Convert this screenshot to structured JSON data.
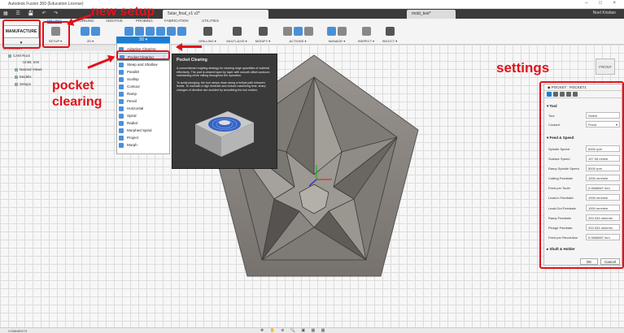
{
  "titlebar": {
    "app_title": "Autodesk Fusion 360 (Education License)"
  },
  "tabs": {
    "doc_tab_1": "5star_final_v1 v2*",
    "doc_tab_2": "mold_test*",
    "user": "Noel Kristian"
  },
  "ribbon": {
    "workspace": "MANUFACTURE",
    "tabs": [
      "MILLING",
      "TURNING",
      "ADDITIVE",
      "PROBING",
      "FABRICATION",
      "UTILITIES"
    ],
    "groups": {
      "setup": "SETUP",
      "twod": "2D",
      "threed": "3D",
      "drilling": "DRILLING",
      "multiaxis": "MULTI-AXIS",
      "modify": "MODIFY",
      "actions": "ACTIONS",
      "manage": "MANAGE",
      "inspect": "INSPECT",
      "select": "SELECT"
    }
  },
  "browser": {
    "header": "BROWSER",
    "items": [
      "CAM Root",
      "Units: mm",
      "Named Views",
      "Models",
      "Setups"
    ]
  },
  "menu": {
    "header": "3D",
    "items": [
      "Adaptive Clearing",
      "Pocket Clearing",
      "Steep and Shallow",
      "Parallel",
      "Scallop",
      "Contour",
      "Ramp",
      "Pencil",
      "Horizontal",
      "Spiral",
      "Radial",
      "Morphed Spiral",
      "Project",
      "Morph"
    ]
  },
  "tooltip": {
    "title": "Pocket Clearing",
    "p1": "A conventional roughing strategy for clearing large quantities of material effectively. The part is cleared layer by layer with smooth offset contours maintaining climb milling throughout the operation.",
    "p2": "To avoid plunging, the tool ramps down along a helical path between levels. To maintain a high feedrate and reduce machining time, sharp changes of direction are avoided by smoothing the tool motion."
  },
  "dialog": {
    "title": "POCKET : POCKET1",
    "tool_section": "Tool",
    "tool_label": "Tool",
    "tool_value": "Select",
    "coolant_label": "Coolant",
    "coolant_value": "Flood",
    "feed_section": "Feed & Speed",
    "rows": [
      {
        "label": "Spindle Speed",
        "value": "5000 rpm"
      },
      {
        "label": "Surface Speed",
        "value": "157.08 m/min"
      },
      {
        "label": "Ramp Spindle Speed",
        "value": "5000 rpm"
      },
      {
        "label": "Cutting Feedrate",
        "value": "1000 mm/min"
      },
      {
        "label": "Feed per Tooth",
        "value": "0.0666667 mm"
      },
      {
        "label": "Lead-In Feedrate",
        "value": "1000 mm/min"
      },
      {
        "label": "Lead-Out Feedrate",
        "value": "1000 mm/min"
      },
      {
        "label": "Ramp Feedrate",
        "value": "333.333 mm/min"
      },
      {
        "label": "Plunge Feedrate",
        "value": "333.333 mm/min"
      },
      {
        "label": "Feed per Revolution",
        "value": "0.0666667 mm"
      }
    ],
    "shaft_section": "Shaft & Holder",
    "ok": "OK",
    "cancel": "Cancel"
  },
  "viewcube": "FRONT",
  "annotations": {
    "new_setup": "new setup",
    "pocket_clearing": "pocket clearing",
    "settings": "settings"
  },
  "bottom": {
    "comments": "COMMENTS"
  },
  "colors": {
    "annotation_red": "#e0121b",
    "accent_blue": "#1a7fd4",
    "part_gray": "#8f8b86"
  }
}
